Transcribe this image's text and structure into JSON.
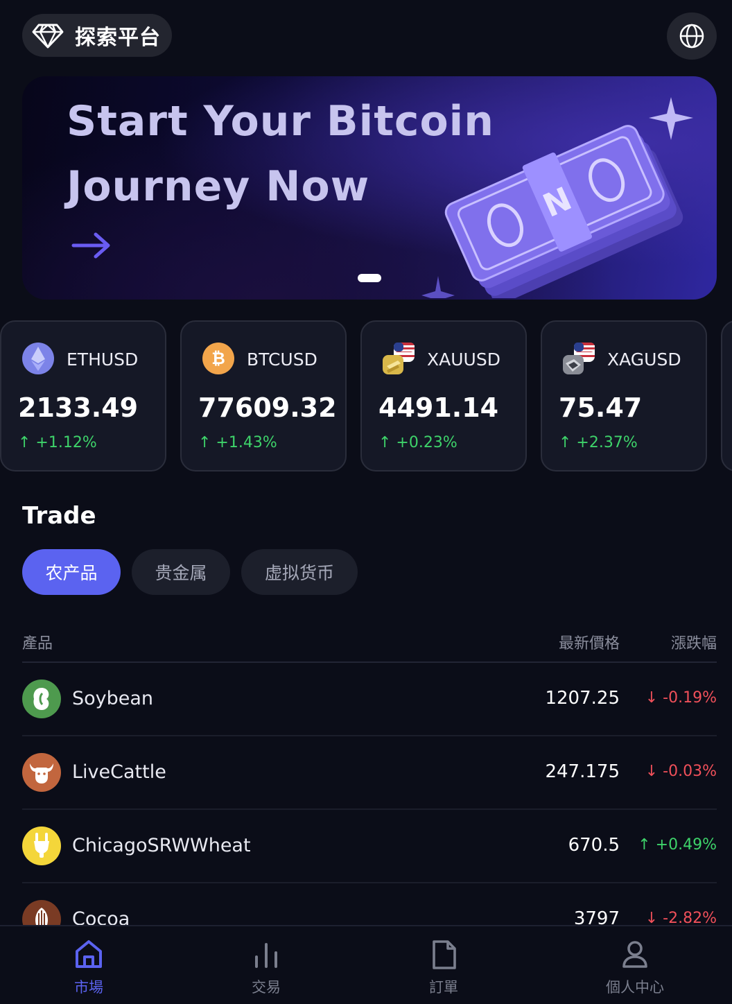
{
  "header": {
    "brand_name": "探索平台",
    "brand_icon": "diamond-icon",
    "language_icon": "globe-icon"
  },
  "banner": {
    "title_line1": "Start Your Bitcoin",
    "title_line2": "Journey Now",
    "arrow_icon": "arrow-right-icon",
    "slide_index": 1
  },
  "tickers": [
    {
      "symbol": "ETHUSD",
      "price": "2133.49",
      "change": "↑ +1.12%",
      "icon": "ethereum-icon"
    },
    {
      "symbol": "BTCUSD",
      "price": "77609.32",
      "change": "↑ +1.43%",
      "icon": "bitcoin-icon"
    },
    {
      "symbol": "XAUUSD",
      "price": "4491.14",
      "change": "↑ +0.23%",
      "icon": "gold-usd-icon"
    },
    {
      "symbol": "XAGUSD",
      "price": "75.47",
      "change": "↑ +2.37%",
      "icon": "silver-usd-icon"
    }
  ],
  "trade": {
    "title": "Trade",
    "tabs": [
      "农产品",
      "贵金属",
      "虚拟货币"
    ],
    "active_tab": 0,
    "columns": {
      "product": "產品",
      "price": "最新價格",
      "change": "漲跌幅"
    },
    "rows": [
      {
        "name": "Soybean",
        "price": "1207.25",
        "change": "↓ -0.19%",
        "direction": "down",
        "icon": "soybean-icon",
        "icon_bg": "#4e9a4e"
      },
      {
        "name": "LiveCattle",
        "price": "247.175",
        "change": "↓ -0.03%",
        "direction": "down",
        "icon": "cattle-icon",
        "icon_bg": "#c2663e"
      },
      {
        "name": "ChicagoSRWWheat",
        "price": "670.5",
        "change": "↑ +0.49%",
        "direction": "up",
        "icon": "wheat-icon",
        "icon_bg": "#f4d63a"
      },
      {
        "name": "Cocoa",
        "price": "3797",
        "change": "↓ -2.82%",
        "direction": "down",
        "icon": "cocoa-icon",
        "icon_bg": "#7a3b24"
      }
    ]
  },
  "nav": [
    {
      "label": "市場",
      "icon": "home-icon",
      "active": true
    },
    {
      "label": "交易",
      "icon": "bar-chart-icon",
      "active": false
    },
    {
      "label": "訂單",
      "icon": "document-icon",
      "active": false
    },
    {
      "label": "個人中心",
      "icon": "user-icon",
      "active": false
    }
  ],
  "colors": {
    "background": "#0b0d18",
    "accent": "#5b63f0",
    "up": "#3ed36a",
    "down": "#f0505a",
    "card": "#151826"
  }
}
